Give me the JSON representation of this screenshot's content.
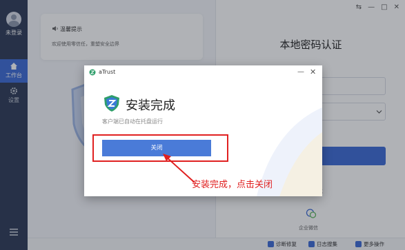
{
  "sidebar": {
    "user_label": "未登录",
    "items": [
      {
        "label": "工作台",
        "icon": "home-icon",
        "active": true
      },
      {
        "label": "设置",
        "icon": "gear-icon",
        "active": false
      }
    ],
    "menu_icon": "menu-icon"
  },
  "notice": {
    "title": "温馨提示",
    "text": "欢迎使用零信任，重塑安全边界",
    "icon": "speaker-icon"
  },
  "login_panel": {
    "title": "本地密码认证",
    "partial_text": "式",
    "wechat_label": "企业微信"
  },
  "window_controls": {
    "switch": "⇆",
    "minimize": "—",
    "maximize": "□",
    "close": "✕"
  },
  "bottom_bar": {
    "items": [
      {
        "label": "诊断修复",
        "icon": "diagnose-icon"
      },
      {
        "label": "日志搜集",
        "icon": "log-icon"
      },
      {
        "label": "更多操作",
        "icon": "more-icon"
      }
    ]
  },
  "dialog": {
    "app_name": "aTrust",
    "title": "安装完成",
    "subtitle": "客户端已自动在托盘运行",
    "close_button": "关闭",
    "minimize": "—",
    "close": "✕"
  },
  "annotation": {
    "text": "安装完成，点击关闭",
    "color": "#e02020"
  },
  "colors": {
    "sidebar": "#2d3a56",
    "accent": "#3d6bd6",
    "button": "#4a7bd8",
    "highlight": "#e02020"
  }
}
